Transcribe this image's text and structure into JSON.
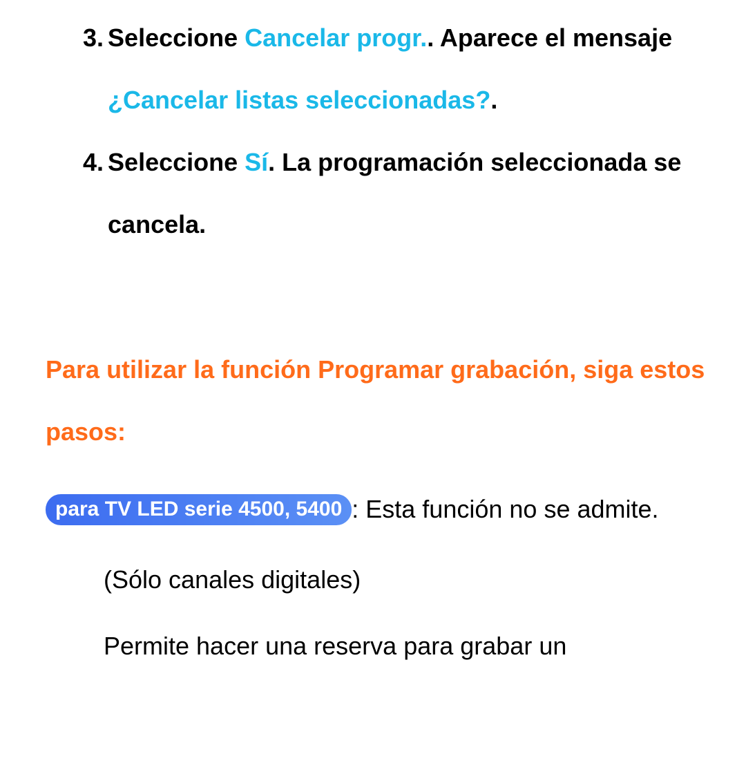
{
  "step3": {
    "marker": "3.",
    "t1": "Seleccione ",
    "hl1": "Cancelar progr.",
    "t2": ". Aparece el mensaje ",
    "hl2": "¿Cancelar listas seleccionadas?",
    "t3": "."
  },
  "step4": {
    "marker": "4.",
    "t1": "Seleccione ",
    "hl1": "Sí",
    "t2": ". La programación seleccionada se cancela."
  },
  "heading": "Para utilizar la función Programar grabación, siga estos pasos:",
  "note": {
    "pill": "para TV LED serie 4500, 5400",
    "rest": ": Esta función no se admite."
  },
  "sub1": "(Sólo canales digitales)",
  "sub2": "Permite hacer una reserva para grabar un"
}
